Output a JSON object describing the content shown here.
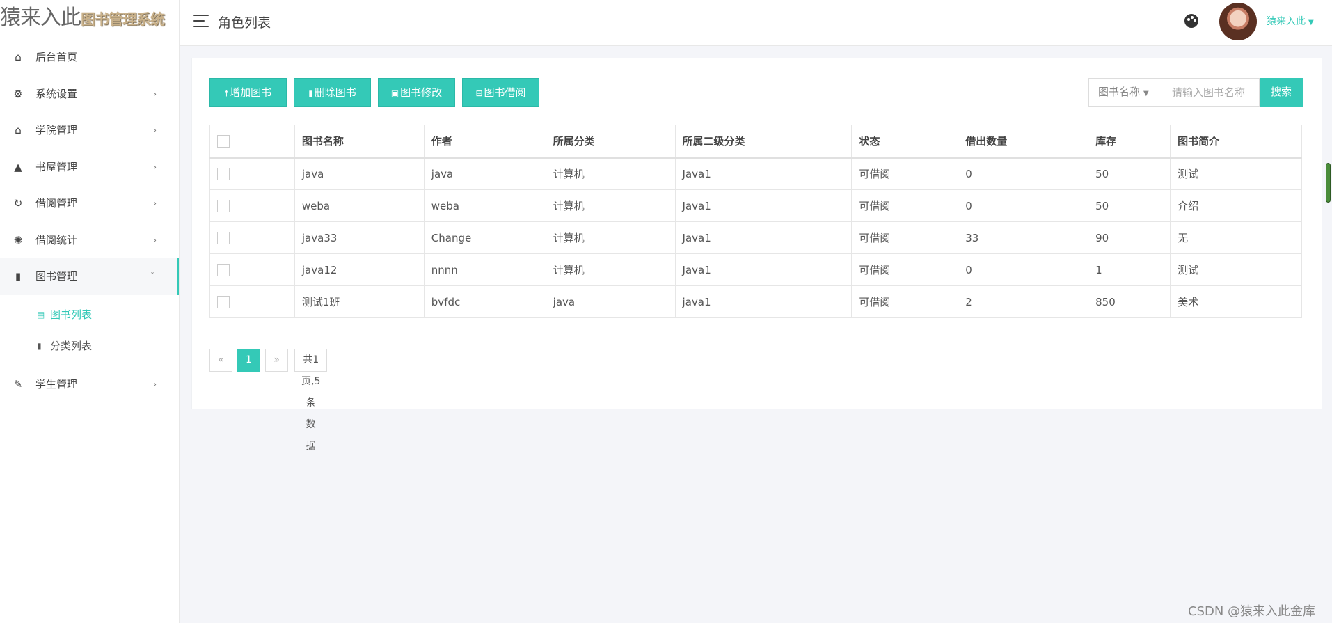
{
  "sidebar": {
    "logo_main": "猿来入此",
    "logo_sub": "图书管理系统",
    "items": [
      {
        "label": "后台首页"
      },
      {
        "label": "系统设置"
      },
      {
        "label": "学院管理"
      },
      {
        "label": "书屋管理"
      },
      {
        "label": "借阅管理"
      },
      {
        "label": "借阅统计"
      },
      {
        "label": "图书管理"
      },
      {
        "label": "学生管理"
      }
    ],
    "subitems": [
      {
        "label": "图书列表"
      },
      {
        "label": "分类列表"
      }
    ]
  },
  "header": {
    "page_title": "角色列表",
    "user_name": "猿来入此"
  },
  "toolbar": {
    "add_label": "增加图书",
    "delete_label": "删除图书",
    "edit_label": "图书修改",
    "borrow_label": "图书借阅"
  },
  "search": {
    "field_label": "图书名称",
    "placeholder": "请输入图书名称",
    "button_label": "搜索"
  },
  "table": {
    "columns": [
      "图书名称",
      "作者",
      "所属分类",
      "所属二级分类",
      "状态",
      "借出数量",
      "库存",
      "图书简介"
    ],
    "rows": [
      [
        "java",
        "java",
        "计算机",
        "Java1",
        "可借阅",
        "0",
        "50",
        "测试"
      ],
      [
        "weba",
        "weba",
        "计算机",
        "Java1",
        "可借阅",
        "0",
        "50",
        "介绍"
      ],
      [
        "java33",
        "Change",
        "计算机",
        "Java1",
        "可借阅",
        "33",
        "90",
        "无"
      ],
      [
        "java12",
        "nnnn",
        "计算机",
        "Java1",
        "可借阅",
        "0",
        "1",
        "测试"
      ],
      [
        "测试1班",
        "bvfdc",
        "java",
        "java1",
        "可借阅",
        "2",
        "850",
        "美术"
      ]
    ]
  },
  "pagination": {
    "prev": "«",
    "current": "1",
    "next": "»",
    "info": "共1页,5条数据"
  },
  "watermark": "CSDN @猿来入此金库",
  "colors": {
    "accent": "#34c9b7",
    "background": "#f4f5f9"
  }
}
